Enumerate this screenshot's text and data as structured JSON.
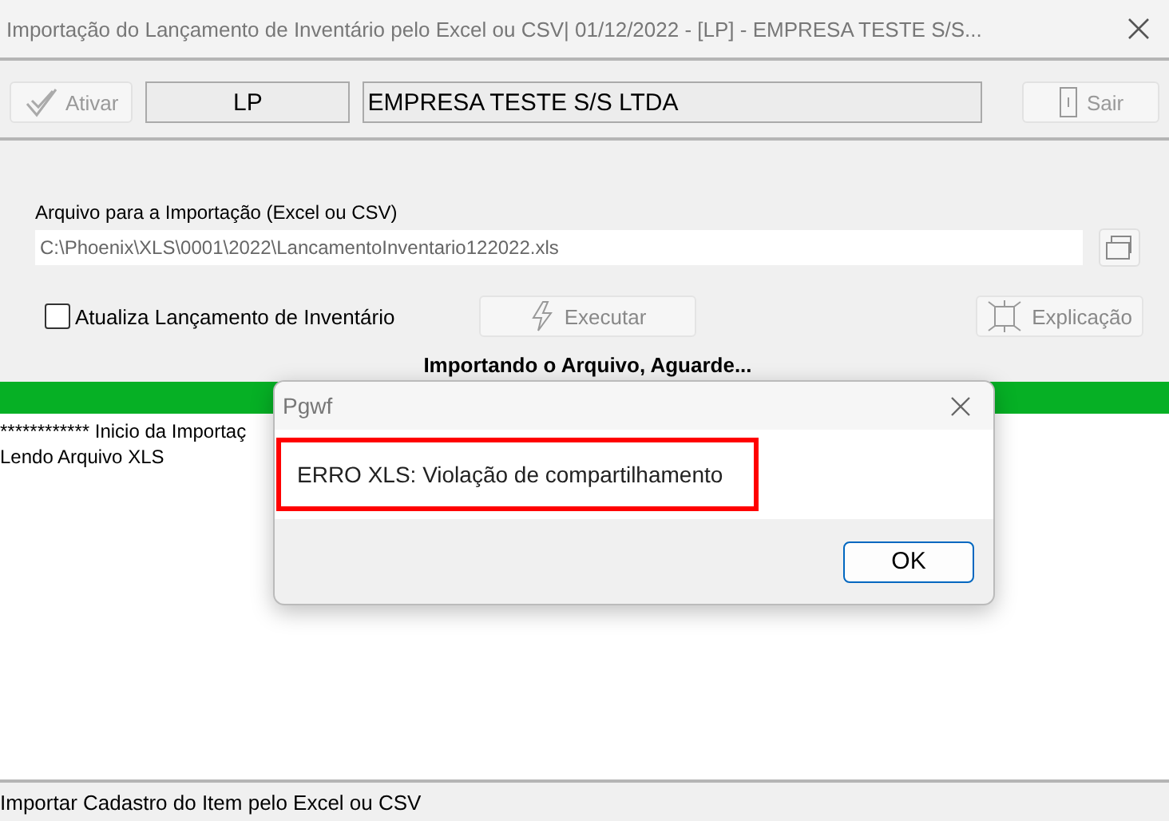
{
  "window": {
    "title": "Importação do Lançamento de Inventário pelo Excel ou CSV|  01/12/2022 - [LP] - EMPRESA TESTE S/S..."
  },
  "toolbar": {
    "buttons": [
      {
        "kind": "activate",
        "label": "Ativar",
        "disabled": true
      },
      {
        "kind": "exit",
        "label": "Sair",
        "disabled": true
      }
    ],
    "code": "LP",
    "company": "EMPRESA TESTE S/S LTDA"
  },
  "file": {
    "label": "Arquivo para a Importação (Excel ou CSV)",
    "value": "C:\\Phoenix\\XLS\\0001\\2022\\LancamentoInventario122022.xls"
  },
  "update_checkbox": {
    "label": "Atualiza Lançamento de Inventário",
    "checked": false
  },
  "actions": [
    {
      "kind": "run",
      "label": "Executar",
      "disabled": true
    },
    {
      "kind": "help",
      "label": "Explicação",
      "disabled": true
    }
  ],
  "progress": {
    "caption": "Importando o Arquivo, Aguarde...",
    "level": 1
  },
  "log": [
    "************ Inicio da Importaç",
    "Lendo Arquivo XLS"
  ],
  "status_bar": "Importar Cadastro do Item pelo Excel ou CSV",
  "dialog": {
    "title": "Pgwf",
    "message": "ERRO XLS: Violação de compartilhamento",
    "highlighted": true,
    "button": "OK"
  }
}
